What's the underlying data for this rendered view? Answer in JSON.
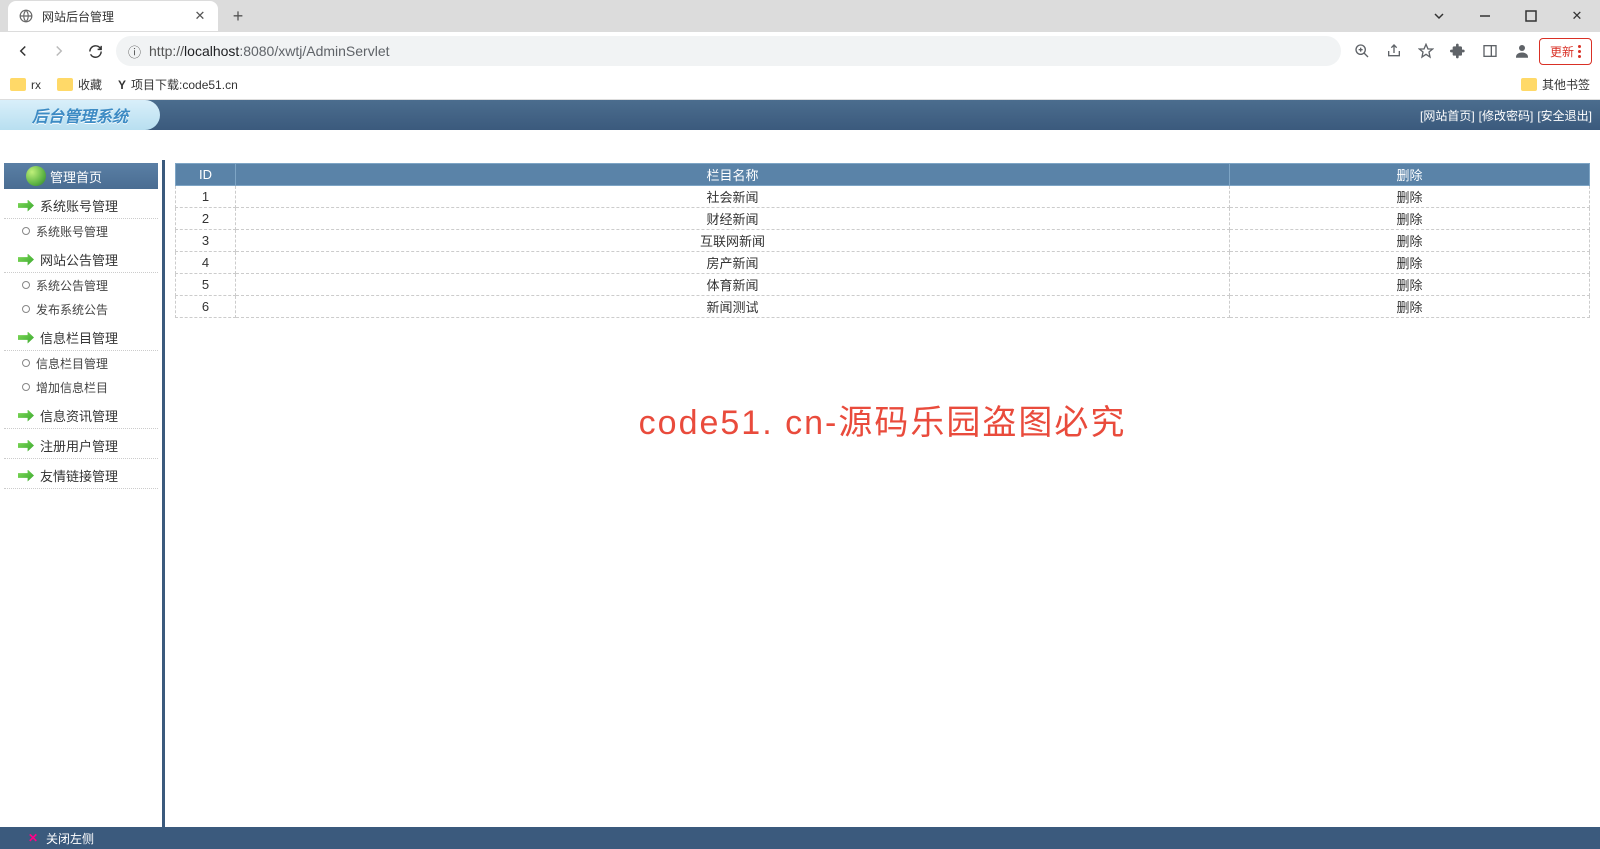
{
  "browser": {
    "tab_title": "网站后台管理",
    "url_prefix": "http://",
    "url_host": "localhost",
    "url_port": ":8080",
    "url_path": "/xwtj/AdminServlet",
    "update_label": "更新"
  },
  "bookmarks": {
    "items": [
      "rx",
      "收藏",
      "项目下载:code51.cn"
    ],
    "other": "其他书签"
  },
  "header": {
    "logo": "后台管理系统",
    "links": [
      "[网站首页]",
      "[修改密码]",
      "[安全退出]"
    ]
  },
  "sidebar": {
    "home": "管理首页",
    "groups": [
      {
        "head": "系统账号管理",
        "subs": [
          "系统账号管理"
        ]
      },
      {
        "head": "网站公告管理",
        "subs": [
          "系统公告管理",
          "发布系统公告"
        ]
      },
      {
        "head": "信息栏目管理",
        "subs": [
          "信息栏目管理",
          "增加信息栏目"
        ]
      },
      {
        "head": "信息资讯管理",
        "subs": []
      },
      {
        "head": "注册用户管理",
        "subs": []
      },
      {
        "head": "友情链接管理",
        "subs": []
      }
    ]
  },
  "table": {
    "headers": {
      "id": "ID",
      "name": "栏目名称",
      "del": "删除"
    },
    "del_label": "删除",
    "rows": [
      {
        "id": "1",
        "name": "社会新闻"
      },
      {
        "id": "2",
        "name": "财经新闻"
      },
      {
        "id": "3",
        "name": "互联网新闻"
      },
      {
        "id": "4",
        "name": "房产新闻"
      },
      {
        "id": "5",
        "name": "体育新闻"
      },
      {
        "id": "6",
        "name": "新闻测试"
      }
    ]
  },
  "watermark": "code51. cn-源码乐园盗图必究",
  "footer": {
    "close_left": "关闭左侧"
  }
}
